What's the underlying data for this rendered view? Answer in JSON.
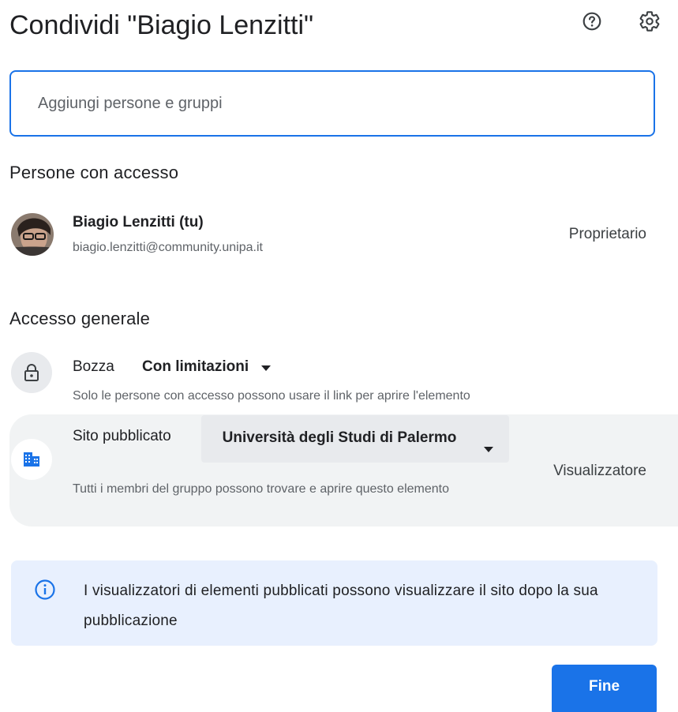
{
  "dialog": {
    "title": "Condividi \"Biagio Lenzitti\"",
    "help_icon": "help-circle-icon",
    "settings_icon": "gear-icon"
  },
  "search": {
    "placeholder": "Aggiungi persone e gruppi",
    "value": ""
  },
  "people_section": {
    "heading": "Persone con accesso",
    "people": [
      {
        "name": "Biagio Lenzitti (tu)",
        "email": "biagio.lenzitti@community.unipa.it",
        "role": "Proprietario"
      }
    ]
  },
  "general_access": {
    "heading": "Accesso generale",
    "restricted": {
      "label": "Bozza",
      "value": "Con limitazioni",
      "description": "Solo le persone con accesso possono usare il link per aprire l'elemento",
      "icon": "lock-icon"
    },
    "published": {
      "label": "Sito pubblicato",
      "value": "Università degli Studi di Palermo",
      "description": "Tutti i membri del gruppo possono trovare e aprire questo elemento",
      "role": "Visualizzatore",
      "icon": "domain-icon"
    }
  },
  "info_banner": {
    "text": "I visualizzatori di elementi pubblicati possono visualizzare il sito dopo la sua pubblicazione",
    "icon": "info-icon"
  },
  "actions": {
    "done_label": "Fine"
  },
  "colors": {
    "accent": "#1a73e8",
    "banner_bg": "#e8f0fe",
    "row_bg": "#f1f3f4",
    "secondary_text": "#5f6368"
  }
}
